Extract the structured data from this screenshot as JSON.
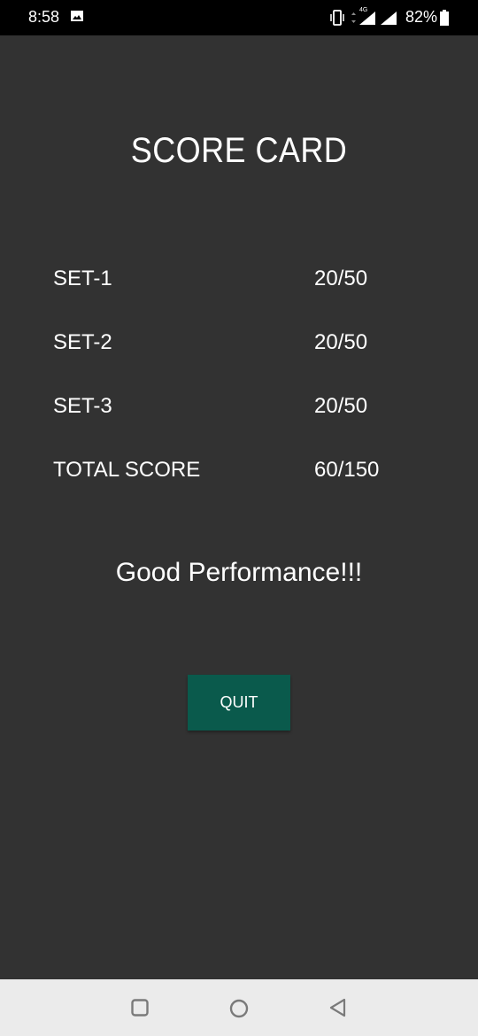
{
  "status_bar": {
    "time": "8:58",
    "network": "4G",
    "battery": "82%"
  },
  "screen": {
    "title": "SCORE CARD",
    "rows": [
      {
        "label": "SET-1",
        "value": "20/50"
      },
      {
        "label": "SET-2",
        "value": "20/50"
      },
      {
        "label": "SET-3",
        "value": "20/50"
      },
      {
        "label": "TOTAL SCORE",
        "value": "60/150"
      }
    ],
    "message": "Good Performance!!!",
    "quit_label": "QUIT"
  },
  "colors": {
    "background": "#323232",
    "button": "#0a5a4c",
    "status_bar": "#000000",
    "nav_bar": "#ebebeb"
  }
}
